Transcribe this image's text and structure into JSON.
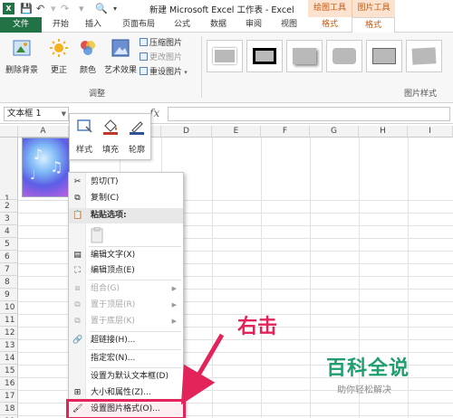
{
  "titlebar": {
    "app_icon": "X",
    "title": "新建 Microsoft Excel 工作表 - Excel",
    "tool_tab_draw": "绘图工具",
    "tool_tab_picture": "图片工具"
  },
  "ribbon_tabs": [
    "文件",
    "开始",
    "插入",
    "页面布局",
    "公式",
    "数据",
    "审阅",
    "视图",
    "格式",
    "格式"
  ],
  "ribbon": {
    "remove_bg": "删除背景",
    "correct": "更正",
    "color": "颜色",
    "art_effects": "艺术效果",
    "compress": "压缩图片",
    "change": "更改图片",
    "reset": "重设图片",
    "group_adjust": "调整",
    "group_styles": "图片样式"
  },
  "formula_bar": {
    "name_box": "文本框 1",
    "fx": "fx"
  },
  "grid": {
    "columns": [
      "A",
      "B",
      "C",
      "D",
      "E",
      "F",
      "G",
      "H",
      "I"
    ],
    "rows": [
      "1",
      "2",
      "3",
      "4",
      "5",
      "6",
      "7",
      "8",
      "9",
      "10",
      "11",
      "12",
      "13",
      "14",
      "15",
      "16",
      "17",
      "18",
      "19"
    ]
  },
  "mini_toolbar": {
    "style": "样式",
    "fill": "填充",
    "outline": "轮廓"
  },
  "context_menu": {
    "cut": "剪切(T)",
    "copy": "复制(C)",
    "paste_options": "粘贴选项:",
    "edit_text": "编辑文字(X)",
    "edit_points": "编辑顶点(E)",
    "group": "组合(G)",
    "bring_front": "置于顶层(R)",
    "send_back": "置于底层(K)",
    "hyperlink": "超链接(H)...",
    "assign_macro": "指定宏(N)...",
    "set_default": "设置为默认文本框(D)",
    "size_props": "大小和属性(Z)...",
    "format_picture": "设置图片格式(O)..."
  },
  "annotation": "右击",
  "watermark": {
    "main": "百科全说",
    "sub": "助你轻松解决"
  }
}
